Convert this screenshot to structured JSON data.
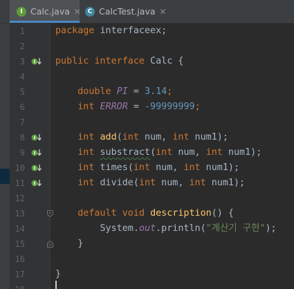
{
  "tabs": [
    {
      "label": "Calc.java",
      "icon": "interface-file-icon",
      "icon_glyph": "I",
      "icon_color": "#5e9c3c",
      "active": true
    },
    {
      "label": "CalcTest.java",
      "icon": "class-file-icon",
      "icon_glyph": "C",
      "icon_color": "#3e86a0",
      "active": false
    }
  ],
  "close_glyph": "✕",
  "lines": {
    "l1": {
      "num": "1",
      "kw": "package",
      "rest": " interfaceex;"
    },
    "l2": {
      "num": "2"
    },
    "l3": {
      "num": "3",
      "kw1": "public",
      "kw2": "interface",
      "rest": " Calc {"
    },
    "l4": {
      "num": "4"
    },
    "l5": {
      "num": "5",
      "type": "double",
      "name": "PI",
      "eq": " = ",
      "val": "3.14",
      "end": ";"
    },
    "l6": {
      "num": "6",
      "type": "int",
      "name": "ERROR",
      "eq": " = ",
      "val": "-99999999",
      "end": ";"
    },
    "l7": {
      "num": "7"
    },
    "l8": {
      "num": "8",
      "type": "int",
      "fn": "add",
      "p1": "int",
      "a1": " num, ",
      "p2": "int",
      "a2": " num1);"
    },
    "l9": {
      "num": "9",
      "type": "int",
      "fn": "substract",
      "p1": "int",
      "a1": " num, ",
      "p2": "int",
      "a2": " num1);"
    },
    "l10": {
      "num": "10",
      "type": "int",
      "fn": "times",
      "p1": "int",
      "a1": " num, ",
      "p2": "int",
      "a2": " num1);"
    },
    "l11": {
      "num": "11",
      "type": "int",
      "fn": "divide",
      "p1": "int",
      "a1": " num, ",
      "p2": "int",
      "a2": " num1);"
    },
    "l12": {
      "num": "12"
    },
    "l13": {
      "num": "13",
      "kw1": "default",
      "kw2": "void",
      "fn": "description",
      "rest": "() {"
    },
    "l14": {
      "num": "14",
      "obj": "System.",
      "field": "out",
      "call": ".println(",
      "str": "\"계산기 구현\"",
      "end": ");"
    },
    "l15": {
      "num": "15",
      "rest": "}"
    },
    "l16": {
      "num": "16"
    },
    "l17": {
      "num": "17",
      "rest": "}"
    },
    "l18": {
      "num": "18"
    }
  },
  "colors": {
    "background": "#2b2b2b",
    "keyword": "#cc7832",
    "method": "#ffc66d",
    "number": "#6897bb",
    "string": "#6a8759",
    "constant": "#9876aa",
    "plain": "#a9b7c6",
    "line_number": "#606366",
    "active_tab_underline": "#4a88c7"
  }
}
